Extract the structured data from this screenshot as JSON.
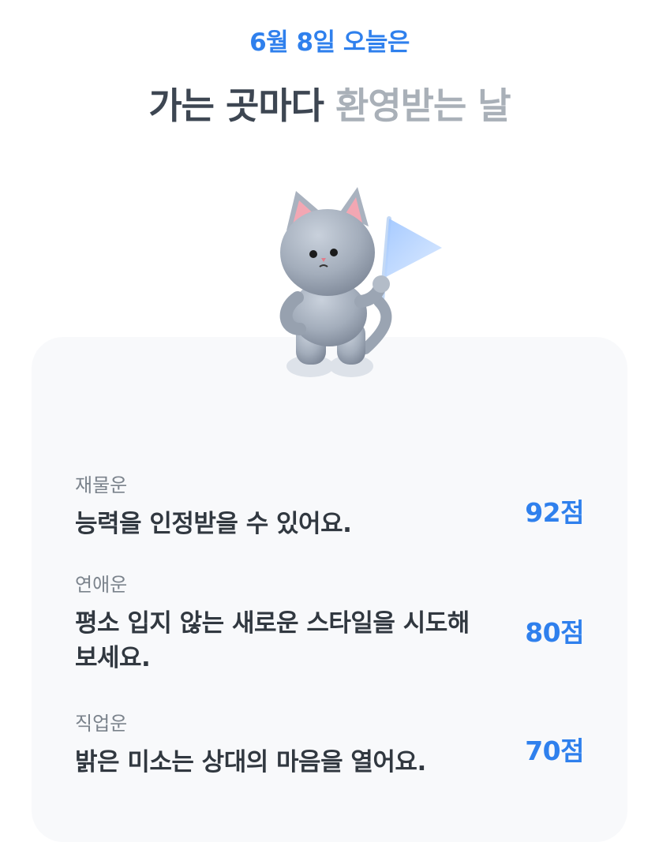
{
  "header": {
    "date_line": "6월 8일 오늘은",
    "headline_strong": "가는 곳마다",
    "headline_soft": "환영받는 날"
  },
  "mascot": {
    "icon": "cat-with-flag-icon"
  },
  "fortunes": [
    {
      "category": "재물운",
      "message": "능력을 인정받을 수 있어요.",
      "score": "92점"
    },
    {
      "category": "연애운",
      "message": "평소 입지 않는 새로운 스타일을 시도해 보세요.",
      "score": "80점"
    },
    {
      "category": "직업운",
      "message": "밝은 미소는 상대의 마음을 열어요.",
      "score": "70점"
    }
  ],
  "colors": {
    "accent": "#2f80ed",
    "text_dark": "#313840",
    "text_muted": "#7b838c",
    "card_bg": "#f8f9fb"
  }
}
